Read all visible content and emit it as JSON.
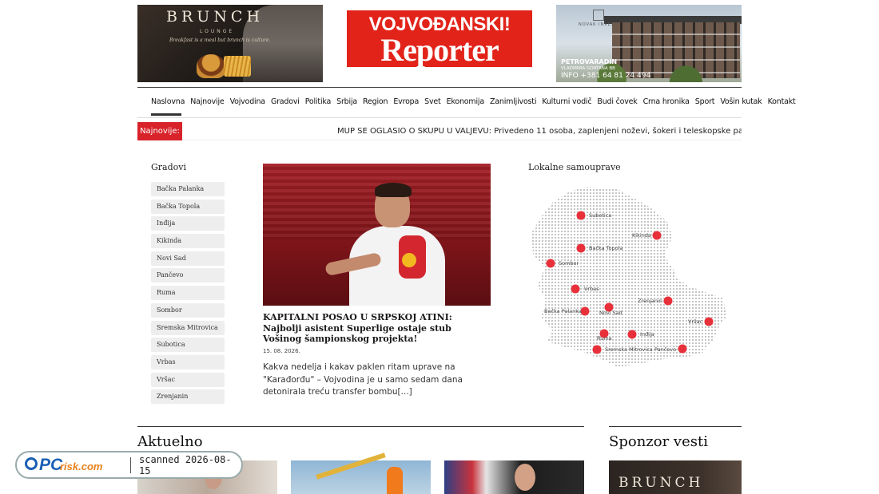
{
  "banners": {
    "left": {
      "brand": "BRUNCH",
      "sub": "LOUNGE",
      "tagline": "Breakfast is a meal but brunch is culture."
    },
    "logo": {
      "line1": "VOJVOĐANSKI!",
      "line2": "Reporter"
    },
    "right": {
      "brand": "NOVAK INVEST",
      "place": "PETROVARADIN",
      "address": "VLADIMIRA GORTANA BB",
      "info": "INFO +381 64 81 24 494"
    }
  },
  "nav": {
    "items": [
      {
        "label": "Naslovna"
      },
      {
        "label": "Najnovije"
      },
      {
        "label": "Vojvodina"
      },
      {
        "label": "Gradovi"
      },
      {
        "label": "Politika"
      },
      {
        "label": "Srbija"
      },
      {
        "label": "Region"
      },
      {
        "label": "Evropa"
      },
      {
        "label": "Svet"
      },
      {
        "label": "Ekonomija"
      },
      {
        "label": "Zanimljivosti"
      },
      {
        "label": "Kulturni vodič"
      },
      {
        "label": "Budi čovek"
      },
      {
        "label": "Crna hronika"
      },
      {
        "label": "Sport"
      },
      {
        "label": "Vošin kutak"
      },
      {
        "label": "Kontakt"
      }
    ]
  },
  "ticker": {
    "label": "Najnovije:",
    "text": "MUP SE OGLASIO O SKUPU U VALJEVU: Privedeno 11 osoba, zaplenjeni noževi, šokeri i teleskopske palice          TRAGED"
  },
  "gradovi": {
    "title": "Gradovi",
    "cities": [
      {
        "label": "Bačka Palanka"
      },
      {
        "label": "Bačka Topola"
      },
      {
        "label": "Inđija"
      },
      {
        "label": "Kikinda"
      },
      {
        "label": "Novi Sad"
      },
      {
        "label": "Pančevo"
      },
      {
        "label": "Ruma"
      },
      {
        "label": "Sombor"
      },
      {
        "label": "Sremska Mitrovica"
      },
      {
        "label": "Subotica"
      },
      {
        "label": "Vrbas"
      },
      {
        "label": "Vršac"
      },
      {
        "label": "Zrenjanin"
      }
    ]
  },
  "article": {
    "title": "KAPITALNI POSAO U SRPSKOJ ATINI: Najbolji asistent Superlige ostaje stub Vošinog šampionskog projekta!",
    "date": "15. 08. 2026.",
    "excerpt": "Kakva nedelja i kakav paklen ritam uprave na \"Karađorđu\" – Vojvodina je u samo sedam dana detonirala treću transfer bombu[...]"
  },
  "map": {
    "title": "Lokalne samouprave",
    "pin_color": "#e8303a",
    "labels": {
      "subotica": "Subotica",
      "kikinda": "Kikinda",
      "backa_topola": "Bačka Topola",
      "sombor": "Sombor",
      "vrbas": "Vrbas",
      "zrenjanin": "Zrenjanin",
      "backa_palanka": "Bačka Palanka",
      "novi_sad": "Novi Sad",
      "vrsac": "Vršac",
      "ruma": "Ruma",
      "indjija": "Inđija",
      "sremska_mitrovica": "Sremska Mitrovica",
      "pancevo": "Pančevo"
    }
  },
  "sections": {
    "aktuelno": "Aktuelno",
    "sponzor": "Sponzor vesti",
    "sponzor_brand": "BRUNCH"
  },
  "watermark": {
    "logo_pc": "PC",
    "logo_risk": "risk.com",
    "scanned": "scanned 2026-08-15"
  },
  "colors": {
    "accent_red": "#d8232a",
    "logo_red": "#e2231a"
  }
}
